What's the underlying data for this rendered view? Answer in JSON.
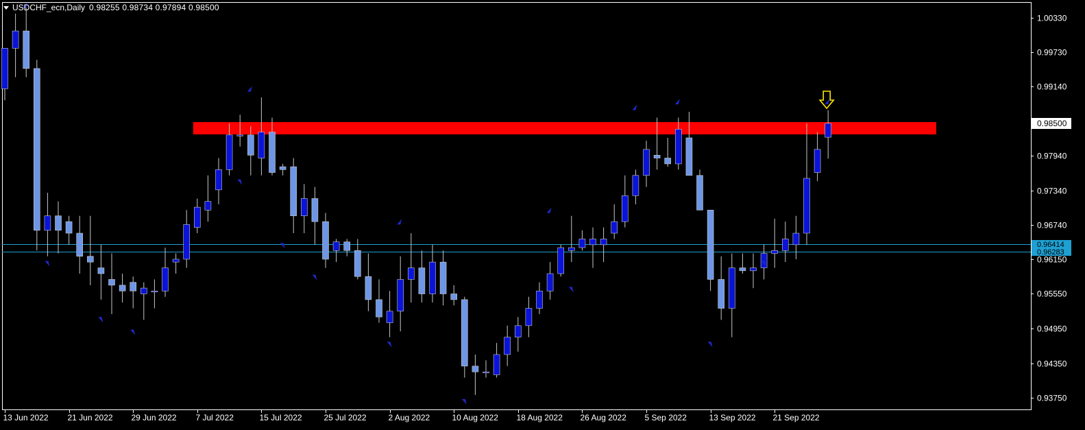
{
  "header": {
    "menu_icon": "triangle-down-icon",
    "symbol": "USDCHF_ecn,Daily",
    "ohlc": "0.98255 0.98734 0.97894 0.98500"
  },
  "colors": {
    "background": "#000000",
    "frame": "#ffffff",
    "bull_fill": "#0a14d8",
    "bear_fill": "#6e96e6",
    "wick": "#c8c8c8",
    "fractal": "#1e28c8",
    "resistance_zone": "#ff0000",
    "support_line": "#1ea0d2",
    "label_box": "#1ea0d2",
    "arrow": "#ffe600"
  },
  "chart_data": {
    "type": "candlestick",
    "symbol": "USDCHF_ecn",
    "timeframe": "Daily",
    "ylim": [
      0.9355,
      1.006
    ],
    "y_ticks": [
      "1.00330",
      "0.99730",
      "0.99140",
      "0.98500",
      "0.97940",
      "0.97340",
      "0.96740",
      "0.96150",
      "0.95550",
      "0.94950",
      "0.94350",
      "0.93750"
    ],
    "x_ticks": [
      {
        "index": 0,
        "label": "13 Jun 2022"
      },
      {
        "index": 6,
        "label": "21 Jun 2022"
      },
      {
        "index": 12,
        "label": "29 Jun 2022"
      },
      {
        "index": 18,
        "label": "7 Jul 2022"
      },
      {
        "index": 24,
        "label": "15 Jul 2022"
      },
      {
        "index": 30,
        "label": "25 Jul 2022"
      },
      {
        "index": 36,
        "label": "2 Aug 2022"
      },
      {
        "index": 42,
        "label": "10 Aug 2022"
      },
      {
        "index": 48,
        "label": "18 Aug 2022"
      },
      {
        "index": 54,
        "label": "26 Aug 2022"
      },
      {
        "index": 60,
        "label": "5 Sep 2022"
      },
      {
        "index": 66,
        "label": "13 Sep 2022"
      },
      {
        "index": 72,
        "label": "21 Sep 2022"
      }
    ],
    "candles": [
      [
        0.991,
        0.9935,
        0.989,
        0.998
      ],
      [
        0.998,
        1.004,
        0.993,
        1.001
      ],
      [
        1.001,
        1.005,
        0.993,
        0.9945
      ],
      [
        0.9945,
        0.996,
        0.963,
        0.9665
      ],
      [
        0.9665,
        0.973,
        0.962,
        0.969
      ],
      [
        0.969,
        0.9715,
        0.9625,
        0.9665
      ],
      [
        0.968,
        0.969,
        0.964,
        0.966
      ],
      [
        0.966,
        0.969,
        0.959,
        0.962
      ],
      [
        0.962,
        0.969,
        0.957,
        0.961
      ],
      [
        0.96,
        0.964,
        0.9545,
        0.959
      ],
      [
        0.958,
        0.9625,
        0.952,
        0.957
      ],
      [
        0.957,
        0.959,
        0.954,
        0.956
      ],
      [
        0.9575,
        0.9585,
        0.953,
        0.956
      ],
      [
        0.9555,
        0.9575,
        0.951,
        0.9565
      ],
      [
        0.956,
        0.958,
        0.953,
        0.956
      ],
      [
        0.956,
        0.9635,
        0.955,
        0.96
      ],
      [
        0.961,
        0.9625,
        0.959,
        0.9615
      ],
      [
        0.9615,
        0.97,
        0.96,
        0.9675
      ],
      [
        0.967,
        0.972,
        0.966,
        0.9705
      ],
      [
        0.97,
        0.976,
        0.968,
        0.9715
      ],
      [
        0.9735,
        0.979,
        0.971,
        0.977
      ],
      [
        0.977,
        0.985,
        0.976,
        0.983
      ],
      [
        0.983,
        0.9865,
        0.981,
        0.983
      ],
      [
        0.983,
        0.9845,
        0.976,
        0.9795
      ],
      [
        0.979,
        0.9895,
        0.976,
        0.9835
      ],
      [
        0.9835,
        0.986,
        0.976,
        0.9765
      ],
      [
        0.9775,
        0.978,
        0.976,
        0.977
      ],
      [
        0.9775,
        0.979,
        0.966,
        0.969
      ],
      [
        0.969,
        0.9745,
        0.966,
        0.972
      ],
      [
        0.972,
        0.974,
        0.964,
        0.968
      ],
      [
        0.968,
        0.9695,
        0.96,
        0.9615
      ],
      [
        0.963,
        0.965,
        0.961,
        0.9645
      ],
      [
        0.9645,
        0.965,
        0.962,
        0.963
      ],
      [
        0.963,
        0.965,
        0.958,
        0.9585
      ],
      [
        0.9585,
        0.9625,
        0.9525,
        0.9545
      ],
      [
        0.9545,
        0.958,
        0.9505,
        0.9515
      ],
      [
        0.9505,
        0.956,
        0.948,
        0.9525
      ],
      [
        0.9525,
        0.962,
        0.949,
        0.958
      ],
      [
        0.958,
        0.966,
        0.954,
        0.96
      ],
      [
        0.96,
        0.963,
        0.954,
        0.9555
      ],
      [
        0.9555,
        0.964,
        0.954,
        0.961
      ],
      [
        0.961,
        0.963,
        0.9535,
        0.9555
      ],
      [
        0.9555,
        0.957,
        0.9535,
        0.9545
      ],
      [
        0.9545,
        0.955,
        0.941,
        0.943
      ],
      [
        0.943,
        0.945,
        0.938,
        0.942
      ],
      [
        0.942,
        0.944,
        0.941,
        0.942
      ],
      [
        0.9415,
        0.947,
        0.941,
        0.945
      ],
      [
        0.945,
        0.95,
        0.943,
        0.948
      ],
      [
        0.948,
        0.9515,
        0.9455,
        0.95
      ],
      [
        0.95,
        0.955,
        0.948,
        0.953
      ],
      [
        0.953,
        0.9575,
        0.952,
        0.956
      ],
      [
        0.956,
        0.961,
        0.9545,
        0.959
      ],
      [
        0.959,
        0.964,
        0.9585,
        0.9635
      ],
      [
        0.963,
        0.969,
        0.961,
        0.9635
      ],
      [
        0.9635,
        0.9665,
        0.963,
        0.965
      ],
      [
        0.964,
        0.967,
        0.96,
        0.965
      ],
      [
        0.964,
        0.967,
        0.961,
        0.965
      ],
      [
        0.966,
        0.971,
        0.965,
        0.968
      ],
      [
        0.968,
        0.976,
        0.967,
        0.9725
      ],
      [
        0.9725,
        0.977,
        0.971,
        0.976
      ],
      [
        0.976,
        0.982,
        0.974,
        0.9805
      ],
      [
        0.9795,
        0.986,
        0.977,
        0.979
      ],
      [
        0.979,
        0.9825,
        0.9775,
        0.978
      ],
      [
        0.978,
        0.986,
        0.977,
        0.984
      ],
      [
        0.9825,
        0.987,
        0.976,
        0.976
      ],
      [
        0.976,
        0.977,
        0.97,
        0.97
      ],
      [
        0.97,
        0.97,
        0.956,
        0.958
      ],
      [
        0.958,
        0.962,
        0.951,
        0.953
      ],
      [
        0.953,
        0.9625,
        0.948,
        0.96
      ],
      [
        0.96,
        0.9625,
        0.959,
        0.9595
      ],
      [
        0.9595,
        0.9625,
        0.9565,
        0.96
      ],
      [
        0.96,
        0.964,
        0.958,
        0.9625
      ],
      [
        0.9625,
        0.9685,
        0.96,
        0.963
      ],
      [
        0.963,
        0.968,
        0.961,
        0.965
      ],
      [
        0.964,
        0.969,
        0.9615,
        0.966
      ],
      [
        0.966,
        0.985,
        0.964,
        0.9755
      ],
      [
        0.9765,
        0.9835,
        0.975,
        0.9805
      ],
      [
        0.9826,
        0.9873,
        0.9789,
        0.985
      ]
    ],
    "fractals_up": [
      {
        "index": 2,
        "price": 1.005
      },
      {
        "index": 23,
        "price": 0.9905
      },
      {
        "index": 37,
        "price": 0.9675
      },
      {
        "index": 51,
        "price": 0.9695
      },
      {
        "index": 59,
        "price": 0.9873
      },
      {
        "index": 63,
        "price": 0.9883
      },
      {
        "index": 77,
        "price": 0.9883
      }
    ],
    "fractals_down": [
      {
        "index": 4,
        "price": 0.9612
      },
      {
        "index": 9,
        "price": 0.9515
      },
      {
        "index": 12,
        "price": 0.9493
      },
      {
        "index": 22,
        "price": 0.9753
      },
      {
        "index": 26,
        "price": 0.9643
      },
      {
        "index": 29,
        "price": 0.9588
      },
      {
        "index": 36,
        "price": 0.9472
      },
      {
        "index": 43,
        "price": 0.9373
      },
      {
        "index": 53,
        "price": 0.9567
      },
      {
        "index": 66,
        "price": 0.9472
      },
      {
        "index": 71,
        "price": 0.9612
      }
    ],
    "resistance_zone": {
      "from_index": 18,
      "to_price_top": 0.98523,
      "to_price_bottom": 0.9831
    },
    "support_lines": [
      {
        "label": "0.96414",
        "price": 0.96414
      },
      {
        "label": "0.96283",
        "price": 0.96283
      }
    ],
    "current_price_label": "0.98500",
    "annotation": {
      "type": "down-arrow",
      "index": 77
    }
  }
}
